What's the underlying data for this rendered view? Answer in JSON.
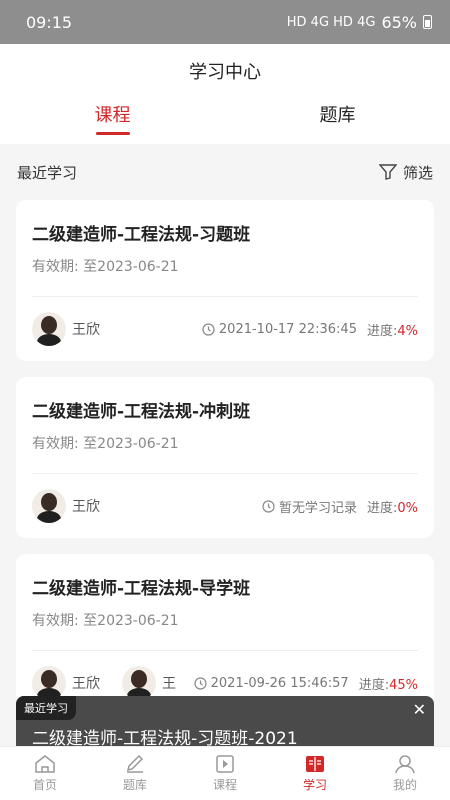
{
  "status": {
    "time": "09:15",
    "battery": "65%",
    "indicators": "HD 4G HD 4G"
  },
  "header": {
    "title": "学习中心",
    "tabs": [
      {
        "label": "课程",
        "active": true
      },
      {
        "label": "题库",
        "active": false
      }
    ]
  },
  "section": {
    "title": "最近学习",
    "filter_label": "筛选"
  },
  "courses": [
    {
      "title": "二级建造师-工程法规-习题班",
      "valid": "有效期: 至2023-06-21",
      "teachers": [
        "王欣"
      ],
      "time": "2021-10-17 22:36:45",
      "progress_label": "进度:",
      "progress": "4%"
    },
    {
      "title": "二级建造师-工程法规-冲刺班",
      "valid": "有效期: 至2023-06-21",
      "teachers": [
        "王欣"
      ],
      "time": "暂无学习记录",
      "progress_label": "进度:",
      "progress": "0%"
    },
    {
      "title": "二级建造师-工程法规-导学班",
      "valid": "有效期: 至2023-06-21",
      "teachers": [
        "王欣",
        "王"
      ],
      "time": "2021-09-26 15:46:57",
      "progress_label": "进度:",
      "progress": "45%"
    }
  ],
  "banner": {
    "tag": "最近学习",
    "text": "二级建造师-工程法规-习题班-2021"
  },
  "nav": [
    {
      "label": "首页",
      "icon": "home-icon"
    },
    {
      "label": "题库",
      "icon": "pencil-icon"
    },
    {
      "label": "课程",
      "icon": "play-icon"
    },
    {
      "label": "学习",
      "icon": "book-icon",
      "active": true
    },
    {
      "label": "我的",
      "icon": "user-icon"
    }
  ],
  "colors": {
    "accent": "#d2282a",
    "status_bar": "#8e8e8e"
  }
}
